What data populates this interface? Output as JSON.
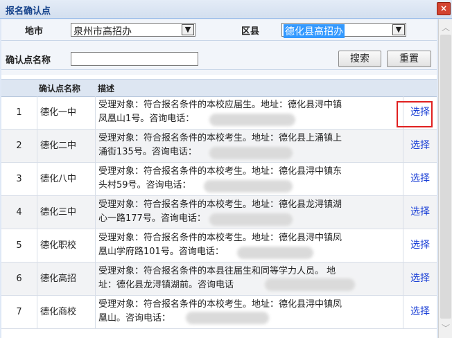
{
  "window": {
    "title": "报名确认点",
    "close_glyph": "×"
  },
  "filters": {
    "city_label": "地市",
    "city_value": "泉州市高招办",
    "district_label": "区县",
    "district_value": "德化县高招办",
    "point_name_label": "确认点名称",
    "point_name_value": "",
    "search_button": "搜索",
    "reset_button": "重置"
  },
  "table": {
    "header": {
      "name": "确认点名称",
      "desc": "描述"
    },
    "action_label": "选择",
    "rows": [
      {
        "no": "1",
        "name": "德化一中",
        "desc1": "受理对象：符合报名条件的本校应届生。地址：德化县浔中镇",
        "desc2": "凤凰山1号。咨询电话："
      },
      {
        "no": "2",
        "name": "德化二中",
        "desc1": "受理对象：符合报名条件的本校考生。地址：德化县上涌镇上",
        "desc2": "涌街135号。咨询电话："
      },
      {
        "no": "3",
        "name": "德化八中",
        "desc1": "受理对象：符合报名条件的本校考生。地址：德化县浔中镇东",
        "desc2": "头村59号。咨询电话："
      },
      {
        "no": "4",
        "name": "德化三中",
        "desc1": "受理对象：符合报名条件的本校考生。地址：德化县龙浔镇湖",
        "desc2": "心一路177号。咨询电话："
      },
      {
        "no": "5",
        "name": "德化职校",
        "desc1": "受理对象：符合报名条件的本校考生。地址：德化县浔中镇凤",
        "desc2": "凰山学府路101号。咨询电话："
      },
      {
        "no": "6",
        "name": "德化高招",
        "desc1": "受理对象：符合报名条件的本县往届生和同等学力人员。 地",
        "desc2": "址：德化县龙浔镇湖前。咨询电话"
      },
      {
        "no": "7",
        "name": "德化商校",
        "desc1": "受理对象：符合报名条件的本校考生。地址：德化县浔中镇凤",
        "desc2": "凰山。咨询电话："
      }
    ]
  },
  "colors": {
    "highlight_box": "#e02020",
    "link": "#1a3fd6",
    "selected_option": "#3399ff"
  }
}
